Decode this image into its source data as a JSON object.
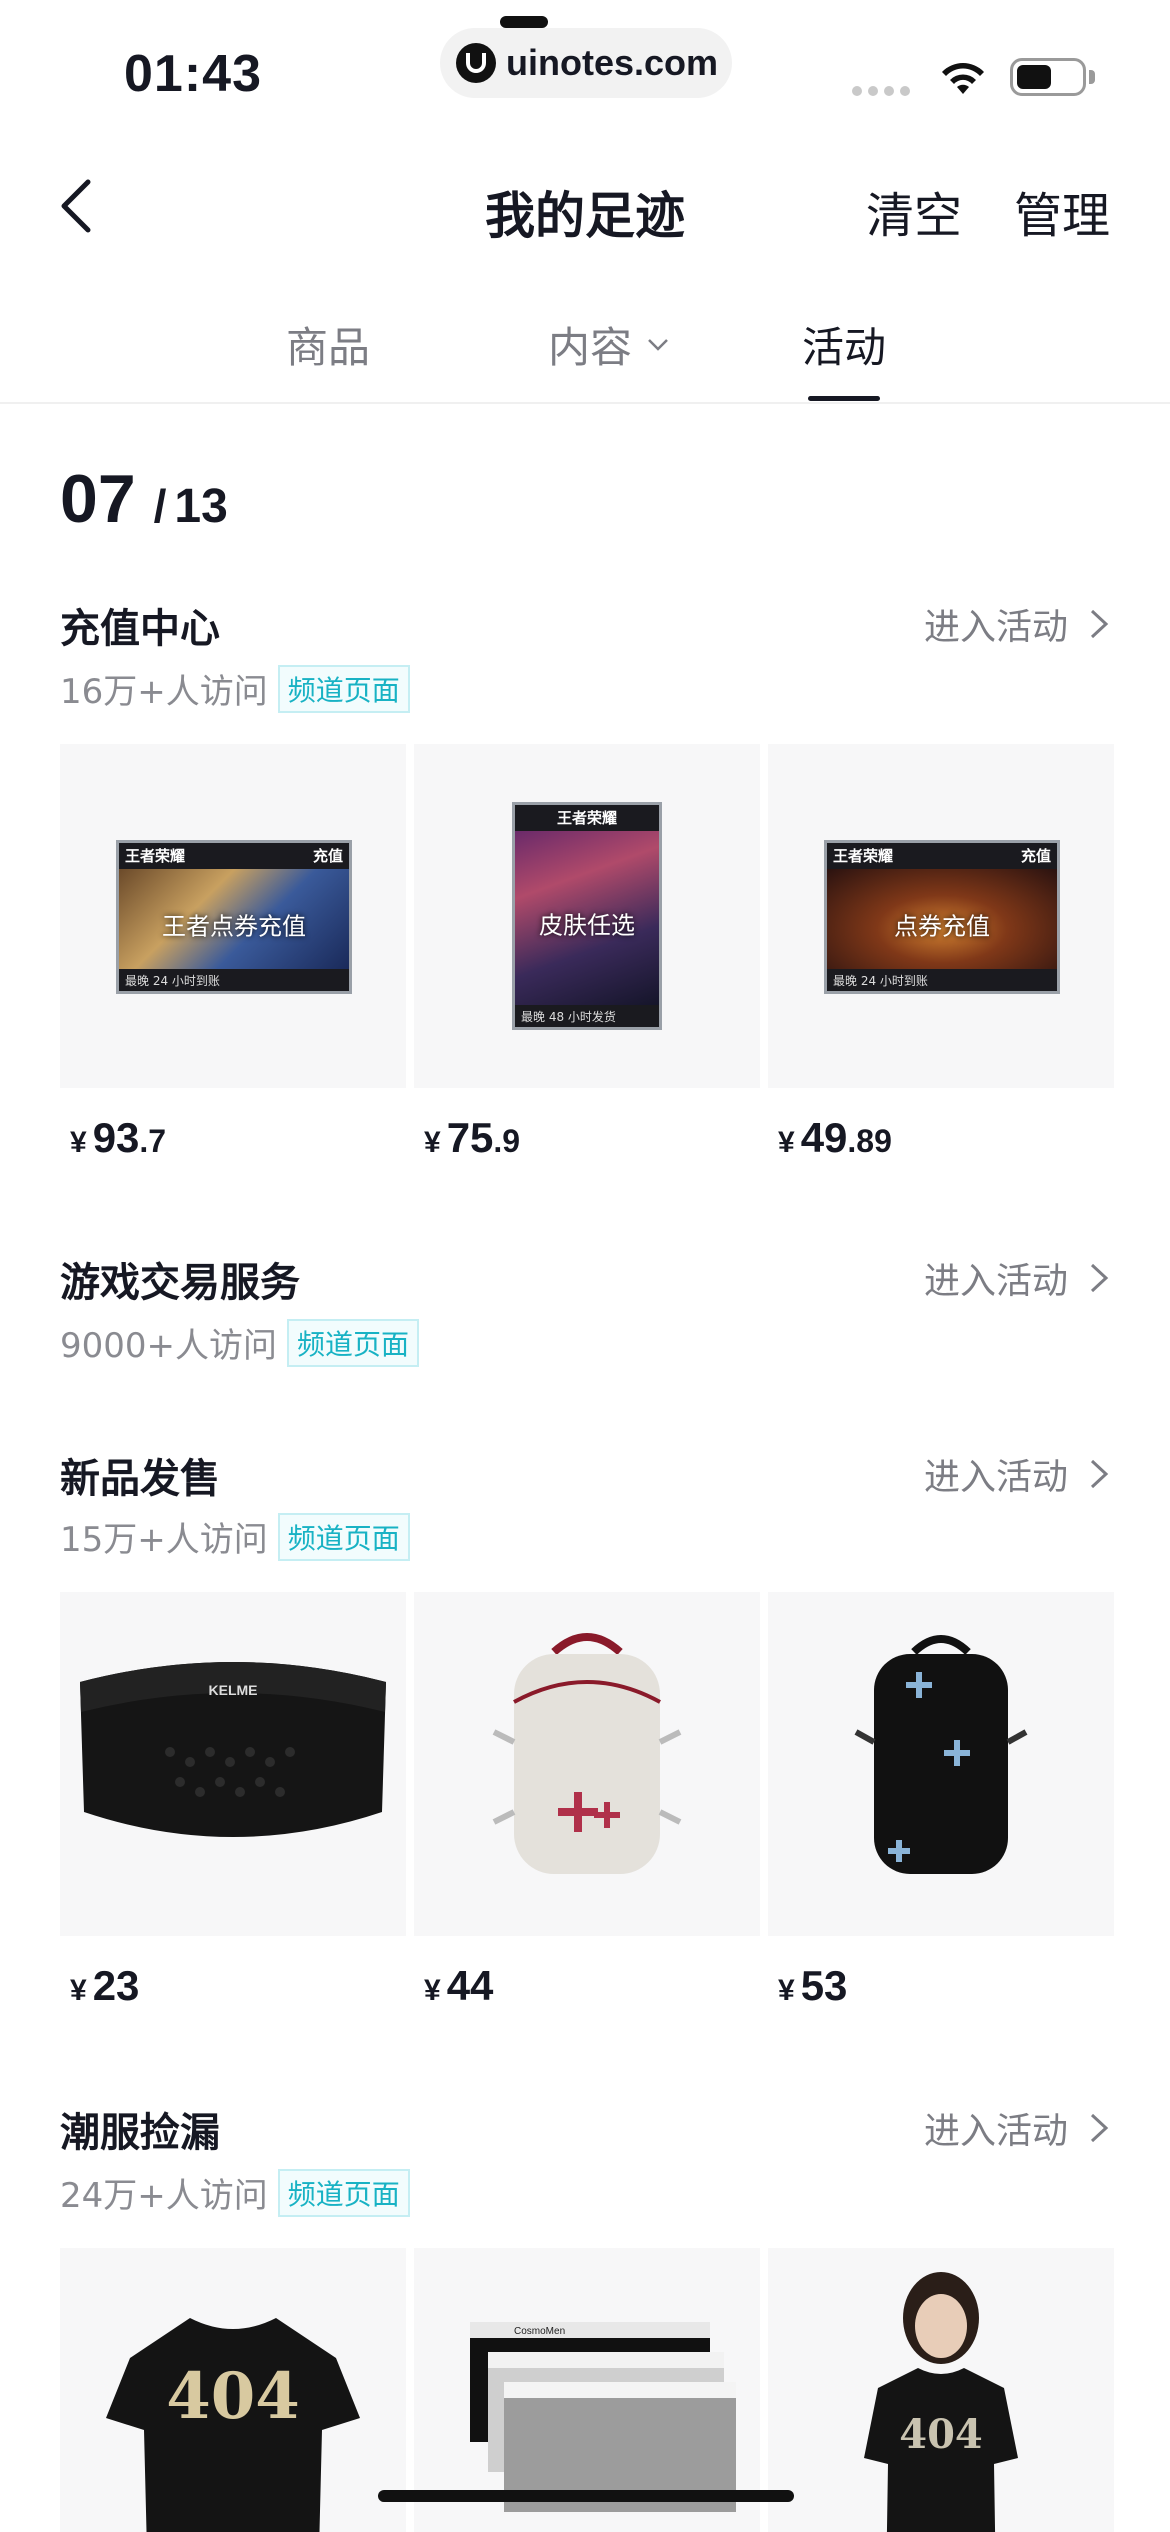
{
  "status_bar": {
    "time": "01:43",
    "url": "uinotes.com"
  },
  "nav": {
    "title": "我的足迹",
    "clear": "清空",
    "manage": "管理"
  },
  "tabs": [
    {
      "label": "商品",
      "active": false
    },
    {
      "label": "内容",
      "active": false
    },
    {
      "label": "活动",
      "active": true
    }
  ],
  "date": {
    "day": "07",
    "separator": "/",
    "month": "13"
  },
  "sections": [
    {
      "title": "充值中心",
      "link": "进入活动",
      "visits": "16万+人访问",
      "badge": "频道页面",
      "items": [
        {
          "header_left": "王者荣耀",
          "header_right": "充值",
          "label": "王者点券充值",
          "footer": "最晚 24 小时到账",
          "yen": "¥",
          "int": "93",
          "dec": ".7"
        },
        {
          "header_left": "王者荣耀",
          "header_right": "",
          "label": "皮肤任选",
          "footer": "最晚 48 小时发货",
          "yen": "¥",
          "int": "75",
          "dec": ".9"
        },
        {
          "header_left": "王者荣耀",
          "header_right": "充值",
          "label": "点券充值",
          "footer": "最晚 24 小时到账",
          "yen": "¥",
          "int": "49",
          "dec": ".89"
        }
      ]
    },
    {
      "title": "游戏交易服务",
      "link": "进入活动",
      "visits": "9000+人访问",
      "badge": "频道页面"
    },
    {
      "title": "新品发售",
      "link": "进入活动",
      "visits": "15万+人访问",
      "badge": "频道页面",
      "items": [
        {
          "name": "kelme-waistband",
          "brand": "KELME",
          "yen": "¥",
          "int": "23",
          "dec": ""
        },
        {
          "name": "white-backpack",
          "yen": "¥",
          "int": "44",
          "dec": ""
        },
        {
          "name": "black-backpack",
          "yen": "¥",
          "int": "53",
          "dec": ""
        }
      ]
    },
    {
      "title": "潮服捡漏",
      "link": "进入活动",
      "visits": "24万+人访问",
      "badge": "频道页面",
      "items": [
        {
          "name": "black-404-tshirt",
          "print": "404"
        },
        {
          "name": "boxer-briefs",
          "brand": "CosmoMen"
        },
        {
          "name": "model-404-tshirt",
          "print": "404"
        }
      ]
    }
  ]
}
